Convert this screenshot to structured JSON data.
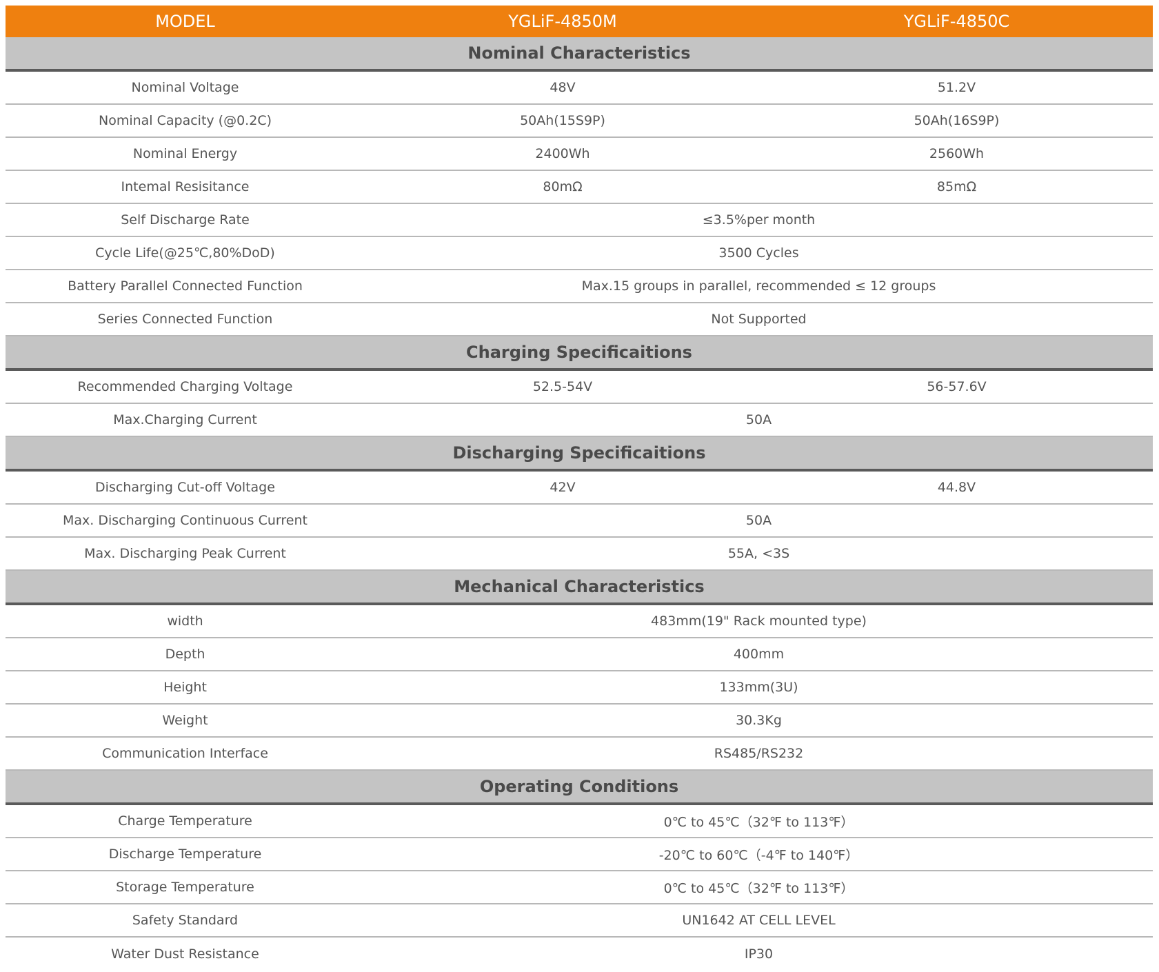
{
  "header": {
    "model_label": "MODEL",
    "model_a": "YGLiF-4850M",
    "model_b": "YGLiF-4850C"
  },
  "sections": [
    {
      "title": "Nominal Characteristics",
      "rows": [
        {
          "label": "Nominal Voltage",
          "a": "48V",
          "b": "51.2V"
        },
        {
          "label": "Nominal Capacity (@0.2C)",
          "a": "50Ah(15S9P)",
          "b": "50Ah(16S9P)"
        },
        {
          "label": "Nominal Energy",
          "a": "2400Wh",
          "b": "2560Wh"
        },
        {
          "label": "Intemal Resisitance",
          "a": "80mΩ",
          "b": "85mΩ"
        },
        {
          "label": "Self Discharge Rate",
          "both": "≤3.5%per month"
        },
        {
          "label": "Cycle Life(@25℃,80%DoD)",
          "both": "3500 Cycles"
        },
        {
          "label": "Battery Parallel Connected Function",
          "both": "Max.15 groups in parallel, recommended ≤ 12 groups"
        },
        {
          "label": "Series Connected Function",
          "both": "Not Supported"
        }
      ]
    },
    {
      "title": "Charging Specificaitions",
      "rows": [
        {
          "label": "Recommended Charging Voltage",
          "a": "52.5-54V",
          "b": "56-57.6V"
        },
        {
          "label": "Max.Charging Current",
          "both": "50A"
        }
      ]
    },
    {
      "title": "Discharging Specificaitions",
      "rows": [
        {
          "label": "Discharging Cut-off Voltage",
          "a": "42V",
          "b": "44.8V"
        },
        {
          "label": "Max. Discharging Continuous Current",
          "both": "50A"
        },
        {
          "label": "Max. Discharging Peak Current",
          "both": "55A, <3S"
        }
      ]
    },
    {
      "title": "Mechanical Characteristics",
      "rows": [
        {
          "label": "width",
          "both": "483mm(19\" Rack mounted type)"
        },
        {
          "label": "Depth",
          "both": "400mm"
        },
        {
          "label": "Height",
          "both": "133mm(3U)"
        },
        {
          "label": "Weight",
          "both": "30.3Kg"
        },
        {
          "label": "Communication Interface",
          "both": "RS485/RS232"
        }
      ]
    },
    {
      "title": "Operating Conditions",
      "rows": [
        {
          "label": "Charge Temperature",
          "both": "0℃ to 45℃（32℉ to 113℉）"
        },
        {
          "label": "Discharge Temperature",
          "both": "-20℃ to 60℃（-4℉ to 140℉）"
        },
        {
          "label": "Storage Temperature",
          "both": "0℃ to 45℃（32℉ to 113℉）"
        },
        {
          "label": "Safety Standard",
          "both": "UN1642 AT CELL LEVEL"
        },
        {
          "label": "Water Dust Resistance",
          "both": "IP30"
        }
      ]
    }
  ],
  "colors": {
    "header_bg": "#ef800f",
    "section_bg": "#c4c4c4",
    "section_rule": "#5a5a5a",
    "row_rule": "#b8b8b8",
    "text": "#555555"
  }
}
